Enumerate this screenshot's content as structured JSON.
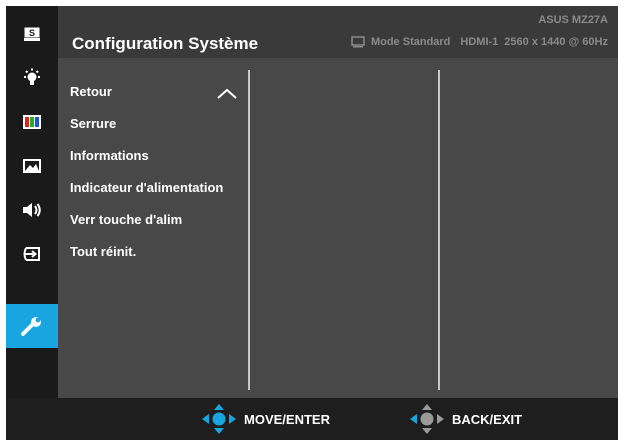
{
  "header": {
    "title": "Configuration Système",
    "model": "ASUS MZ27A",
    "mode": "Mode Standard",
    "input": "HDMI-1",
    "resolution": "2560 x 1440 @ 60Hz"
  },
  "sidebar": {
    "items": [
      {
        "icon": "splendid-s-icon"
      },
      {
        "icon": "blue-light-icon"
      },
      {
        "icon": "color-icon"
      },
      {
        "icon": "image-icon"
      },
      {
        "icon": "sound-icon"
      },
      {
        "icon": "input-select-icon"
      },
      {
        "icon": "wrench-icon",
        "active": true
      }
    ],
    "accent": "#19a6e0"
  },
  "menu": {
    "items": [
      "Retour",
      "Serrure",
      "Informations",
      "Indicateur d'alimentation",
      "Verr touche d'alim",
      "Tout réinit."
    ]
  },
  "footer": {
    "move_label": "MOVE/ENTER",
    "back_label": "BACK/EXIT"
  }
}
